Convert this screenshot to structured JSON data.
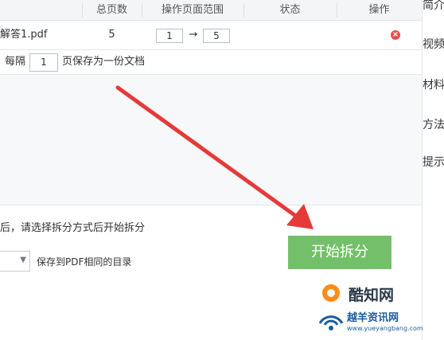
{
  "table": {
    "headers": [
      "总页数",
      "操作页面范围",
      "状态",
      "操作"
    ],
    "rows": [
      {
        "filename": "解答1.pdf",
        "total_pages": "5",
        "range_from": "1",
        "range_to": "5",
        "status": ""
      }
    ],
    "range_arrow": "→"
  },
  "split_options": {
    "label_prefix": "每隔",
    "interval_value": "1",
    "label_suffix": "页保存为一份文档"
  },
  "bottom": {
    "hint": "后，请选择拆分方式后开始拆分",
    "dest_label": "保存到PDF相同的目录",
    "start_button": "开始拆分"
  },
  "right_panel": {
    "items": [
      "简介",
      "视频",
      "材料",
      "方法",
      "提示"
    ]
  },
  "watermark": {
    "main": "酷知网",
    "sub": "越羊资讯网",
    "url": "www.yueyangbang.com"
  },
  "colors": {
    "start_button": "#74c06a",
    "remove_icon": "#e74c4c",
    "arrow": "#e53a3a",
    "header_bg": "#f4f5f7"
  }
}
